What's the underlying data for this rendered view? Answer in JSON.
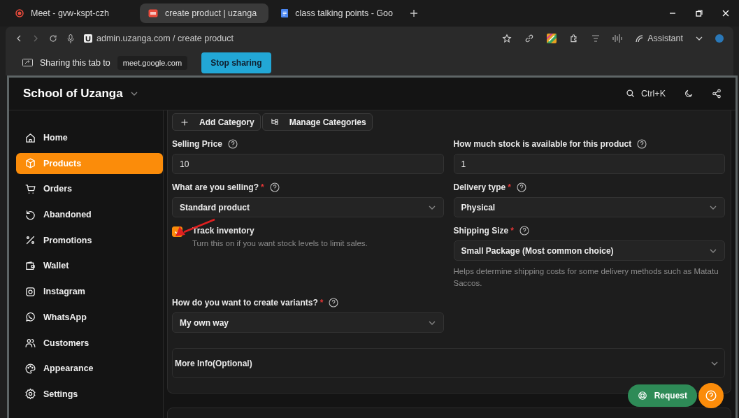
{
  "browser": {
    "tabs": [
      {
        "title": "Meet - gvw-kspt-czh",
        "kind": "meet",
        "selected": false
      },
      {
        "title": "create product | uzanga",
        "kind": "app",
        "selected": true
      },
      {
        "title": "class talking points - Goo",
        "kind": "doc",
        "selected": false
      }
    ],
    "url": "admin.uzanga.com / create product",
    "assistant": "Assistant"
  },
  "sharing": {
    "text": "Sharing this tab to",
    "site": "meet.google.com",
    "button": "Stop sharing"
  },
  "app": {
    "brand": "School of Uzanga",
    "shortcut": "Ctrl+K"
  },
  "sidebar": {
    "items": [
      {
        "label": "Home",
        "selected": false
      },
      {
        "label": "Products",
        "selected": true
      },
      {
        "label": "Orders",
        "selected": false
      },
      {
        "label": "Abandoned",
        "selected": false
      },
      {
        "label": "Promotions",
        "selected": false
      },
      {
        "label": "Wallet",
        "selected": false
      },
      {
        "label": "Instagram",
        "selected": false
      },
      {
        "label": "WhatsApp",
        "selected": false
      },
      {
        "label": "Customers",
        "selected": false
      },
      {
        "label": "Appearance",
        "selected": false
      },
      {
        "label": "Settings",
        "selected": false
      }
    ]
  },
  "category_buttons": [
    "Add Category",
    "Manage Categories"
  ],
  "fields": [
    {
      "label": "Selling Price",
      "kind": "input",
      "value": "10"
    },
    {
      "label": "How much stock is available for this product",
      "kind": "input",
      "value": "1"
    },
    {
      "label": "What are you selling?",
      "required_mark": "*",
      "kind": "select",
      "value": "Standard product"
    },
    {
      "label": "Delivery type",
      "required_mark": "*",
      "kind": "select",
      "value": "Physical"
    },
    {
      "label": "Shipping Size",
      "required_mark": "*",
      "kind": "select",
      "value": "Small Package (Most common choice)",
      "hint": "Helps determine shipping costs for some delivery methods such as Matatu Saccos."
    },
    {
      "label": "How do you want to create variants?",
      "required_mark": "*",
      "kind": "select",
      "value": "My own way"
    }
  ],
  "track_inventory": {
    "label": "Track inventory",
    "hint": "Turn this on if you want stock levels to limit sales.",
    "checked": true
  },
  "more_info": {
    "label": "More Info(Optional)",
    "expanded": false
  },
  "help": {
    "label": "Request"
  }
}
